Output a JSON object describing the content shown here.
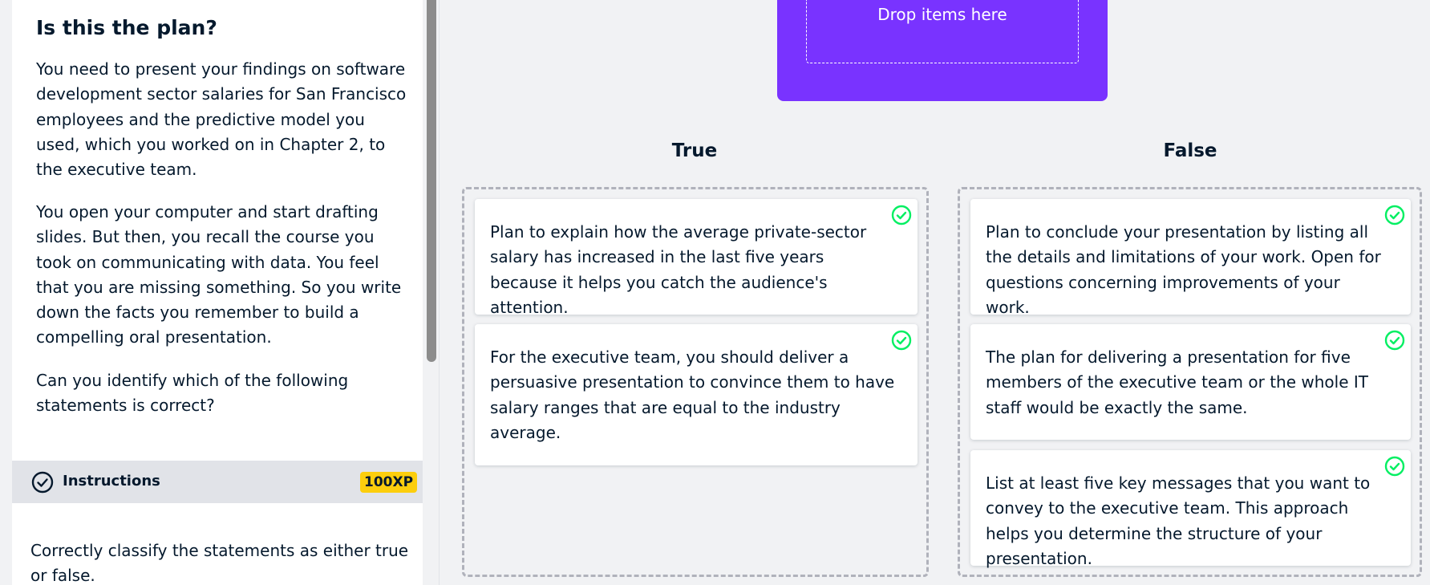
{
  "exercise": {
    "title": "Is this the plan?",
    "paragraphs": [
      "You need to present your findings on software development sector salaries for San Francisco employees and the predictive model you used, which you worked on in Chapter 2, to the executive team.",
      "You open your computer and start drafting slides. But then, you recall the course you took on communicating with data. You feel that you are missing something. So you write down the facts you remember to build a compelling oral presentation.",
      "Can you identify which of the following statements is correct?"
    ]
  },
  "instructions": {
    "label": "Instructions",
    "xp": "100XP",
    "text": "Correctly classify the statements as either true or false.",
    "icon": "check-circle-icon"
  },
  "drop_zone": {
    "label": "Drop items here",
    "color": "#7933ff"
  },
  "columns": {
    "true": {
      "heading": "True",
      "cards": [
        "Plan to explain how the average private-sector salary has increased in the last five years because it helps you catch the audience's attention.",
        "For the executive team, you should deliver a persuasive presentation to convince them to have salary ranges that are equal to the industry average."
      ]
    },
    "false": {
      "heading": "False",
      "cards": [
        "Plan to conclude your presentation by listing all the details and limitations of your work. Open for questions concerning improvements of your work.",
        "The plan for delivering a presentation for five members of the executive team or the whole IT staff would be exactly the same.",
        "List at least five key messages that you want to convey to the executive team. This approach helps you determine the structure of your presentation."
      ]
    }
  },
  "colors": {
    "correct": "#03ef62",
    "xp_badge": "#fcce0d",
    "text": "#05192d"
  }
}
